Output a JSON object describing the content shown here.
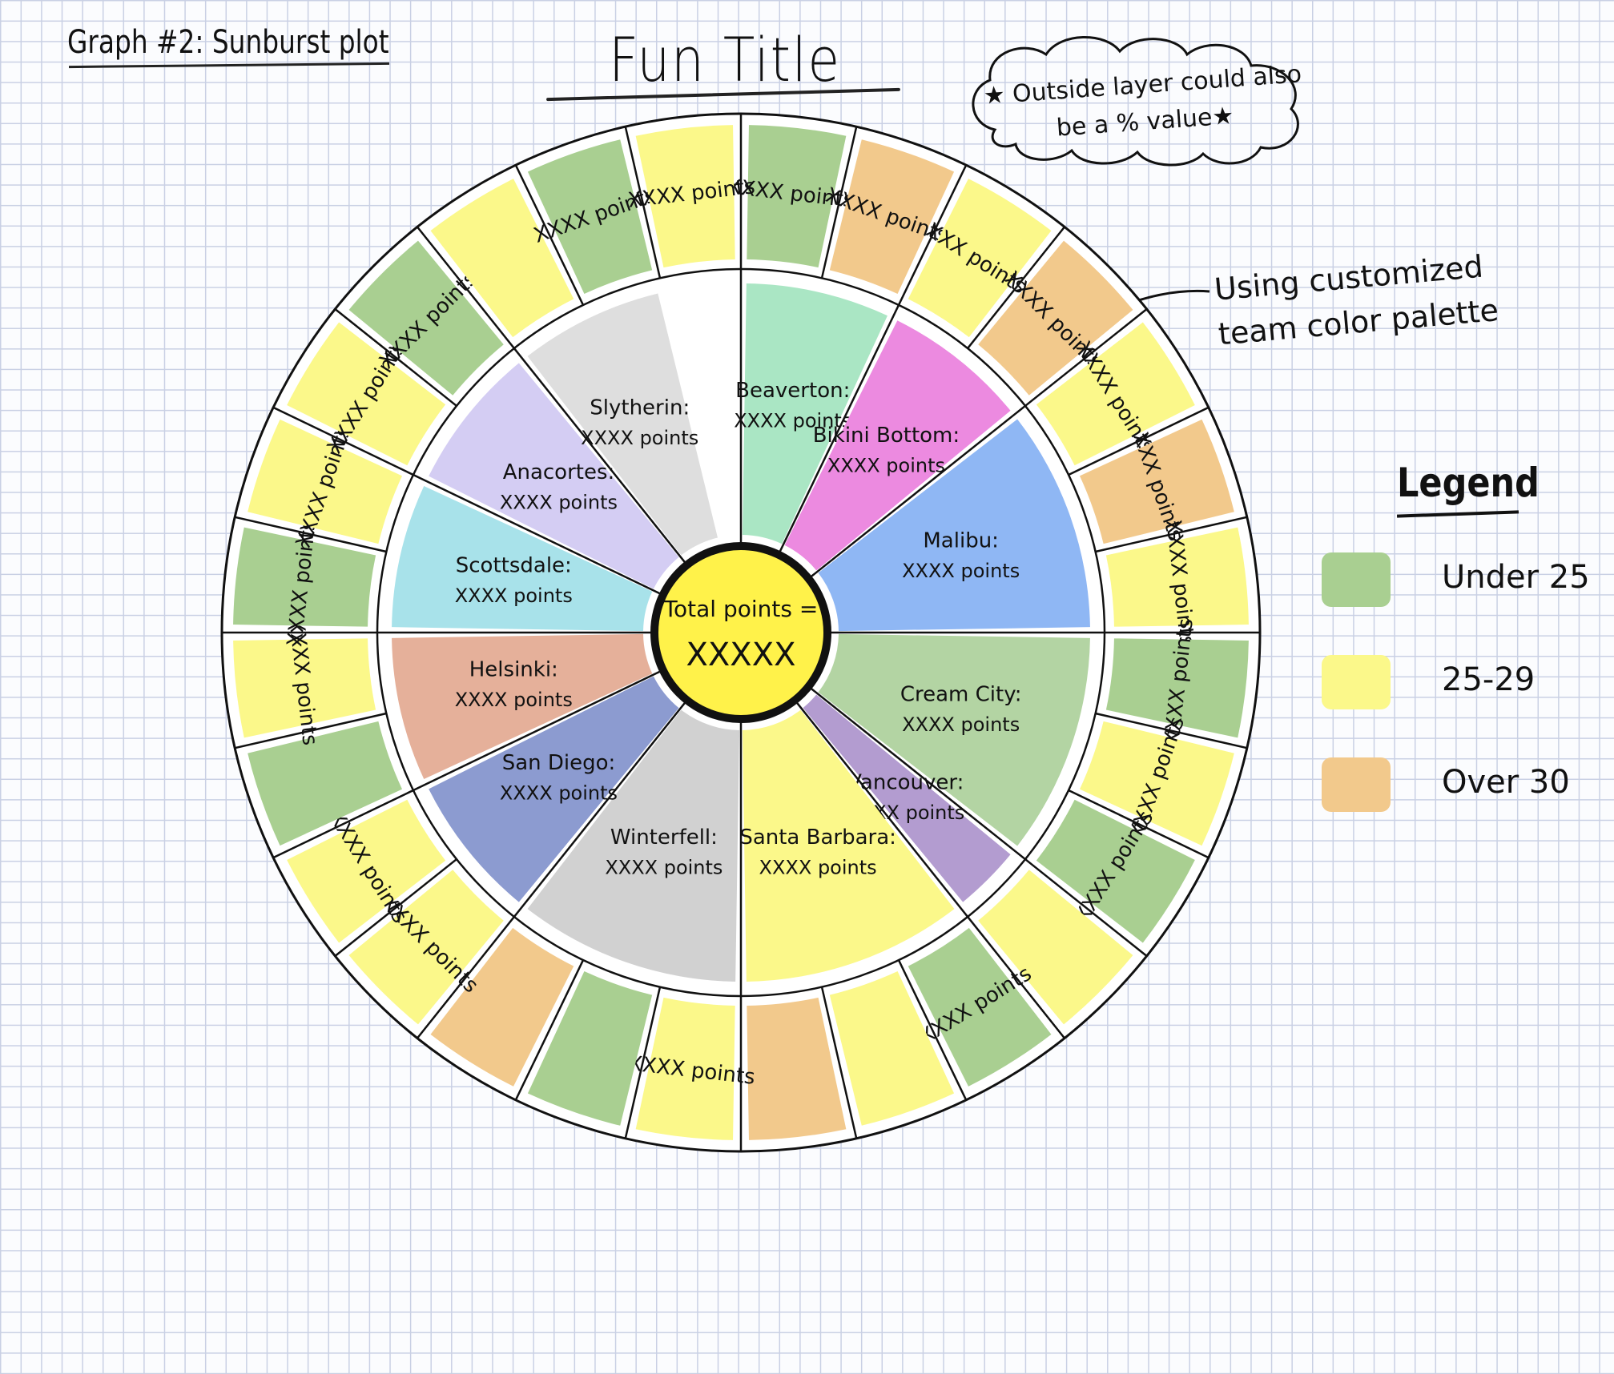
{
  "header": {
    "note": "Graph #2: Sunburst plot",
    "title": "Fun Title"
  },
  "annotations": {
    "callout": "★ Outside layer could also be a % value★",
    "palette_note": "Using customized team color palette"
  },
  "chart_data": {
    "type": "sunburst",
    "title": "Fun Title",
    "center": {
      "label": "Total points =",
      "value": "XXXXX",
      "color": "#fff24a"
    },
    "legend": {
      "title": "Legend",
      "placement": "right",
      "entries": [
        {
          "label": "Under 25",
          "color": "#a9cf91"
        },
        {
          "label": "25-29",
          "color": "#fbf88a"
        },
        {
          "label": "Over 30",
          "color": "#f2c98c"
        }
      ]
    },
    "inner_ring": [
      {
        "name": "Beaverton:",
        "points": "XXXX points",
        "color": "#aae6c4",
        "sectors": 2
      },
      {
        "name": "Bikini Bottom:",
        "points": "XXXX points",
        "color": "#ec8ae0",
        "sectors": 2
      },
      {
        "name": "Malibu:",
        "points": "XXXX points",
        "color": "#8fb7f4",
        "sectors": 3
      },
      {
        "name": "Cream City:",
        "points": "XXXX points",
        "color": "#b3d4a3",
        "sectors": 3
      },
      {
        "name": "Vancouver:",
        "points": "XXXX points",
        "color": "#b39cd0",
        "sectors": 1
      },
      {
        "name": "Santa Barbara:",
        "points": "XXXX points",
        "color": "#fbf88a",
        "sectors": 3
      },
      {
        "name": "Winterfell:",
        "points": "XXXX points",
        "color": "#d1d1d1",
        "sectors": 3
      },
      {
        "name": "San Diego:",
        "points": "XXXX points",
        "color": "#8c9bd0",
        "sectors": 2
      },
      {
        "name": "Helsinki:",
        "points": "XXXX points",
        "color": "#e5b09a",
        "sectors": 2
      },
      {
        "name": "Scottsdale:",
        "points": "XXXX points",
        "color": "#a8e2ea",
        "sectors": 2
      },
      {
        "name": "Anacortes:",
        "points": "XXXX points",
        "color": "#d4cdf3",
        "sectors": 2
      },
      {
        "name": "Slytherin:",
        "points": "XXXX points",
        "color": "#dedede",
        "sectors": 2
      }
    ],
    "outer_ring": [
      {
        "label": "XXXX points",
        "category": "Under 25"
      },
      {
        "label": "XXXX points",
        "category": "Over 30"
      },
      {
        "label": "XXX points",
        "category": "25-29"
      },
      {
        "label": "XXXX points",
        "category": "Over 30"
      },
      {
        "label": "XXXX points",
        "category": "25-29"
      },
      {
        "label": "XXX points",
        "category": "Over 30"
      },
      {
        "label": "XXXX points",
        "category": "25-29"
      },
      {
        "label": "XXXX points",
        "category": "Under 25"
      },
      {
        "label": "XXXX points",
        "category": "25-29"
      },
      {
        "label": "XXXX points",
        "category": "Under 25"
      },
      {
        "label": "",
        "category": "25-29"
      },
      {
        "label": "XXXX points",
        "category": "Under 25"
      },
      {
        "label": "",
        "category": "25-29"
      },
      {
        "label": "",
        "category": "Over 30"
      },
      {
        "label": "XXXX points",
        "category": "25-29"
      },
      {
        "label": "",
        "category": "Under 25"
      },
      {
        "label": "",
        "category": "Over 30"
      },
      {
        "label": "XXXX points",
        "category": "25-29"
      },
      {
        "label": "XXXX points",
        "category": "25-29"
      },
      {
        "label": "",
        "category": "Under 25"
      },
      {
        "label": "XXXX points",
        "category": "25-29"
      },
      {
        "label": "XXXX points",
        "category": "Under 25"
      },
      {
        "label": "XXXX points",
        "category": "25-29"
      },
      {
        "label": "XXXX points",
        "category": "25-29"
      },
      {
        "label": "XXXX points",
        "category": "Under 25"
      },
      {
        "label": "",
        "category": "25-29"
      },
      {
        "label": "XXXX points",
        "category": "Under 25"
      },
      {
        "label": "XXXX points",
        "category": "25-29"
      }
    ]
  }
}
